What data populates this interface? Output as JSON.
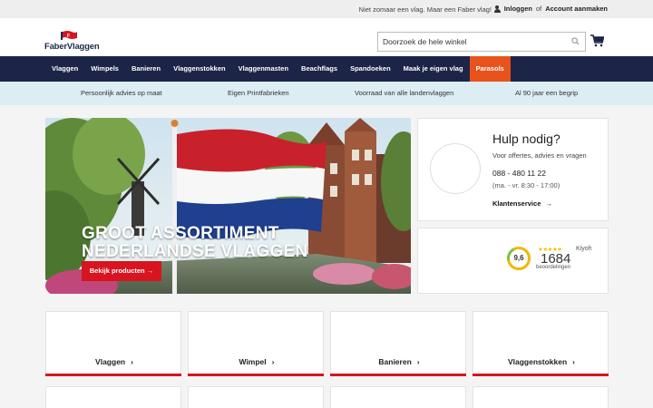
{
  "topbar": {
    "tagline": "Niet zomaar een vlag. Maar een Faber vlag!",
    "login": "Inloggen",
    "or": "of",
    "register": "Account aanmaken"
  },
  "header": {
    "logo_text": "FaberVlaggen",
    "search_placeholder": "Doorzoek de hele winkel"
  },
  "nav": {
    "items": [
      "Vlaggen",
      "Wimpels",
      "Banieren",
      "Vlaggenstokken",
      "Vlaggenmasten",
      "Beachflags",
      "Spandoeken",
      "Maak je eigen vlag",
      "Parasols"
    ]
  },
  "usp": {
    "items": [
      "Persoonlijk advies op maat",
      "Eigen Printfabrieken",
      "Voorraad van alle landenvlaggen",
      "Al 90 jaar een begrip"
    ]
  },
  "hero": {
    "title": "GROOT ASSORTIMENT\nNEDERLANDSE VLAGGEN",
    "button": "Bekijk producten"
  },
  "help": {
    "title": "Hulp nodig?",
    "subtitle": "Voor offertes, advies en vragen",
    "phone": "088 - 480 11 22",
    "hours": "(ma. - vr. 8:30 - 17:00)",
    "link": "Klantenservice"
  },
  "review": {
    "score": "9,6",
    "score_fraction": 0.96,
    "stars": "★★★★★",
    "brand": "Kiyoh",
    "count": "1684",
    "count_label": "beoordelingen"
  },
  "categories": [
    "Vlaggen",
    "Wimpel",
    "Banieren",
    "Vlaggenstokken"
  ],
  "colors": {
    "nav_bg": "#1c2447",
    "accent_orange": "#e8521d",
    "accent_red": "#d7141f",
    "usp_bg": "#dcedf4"
  }
}
